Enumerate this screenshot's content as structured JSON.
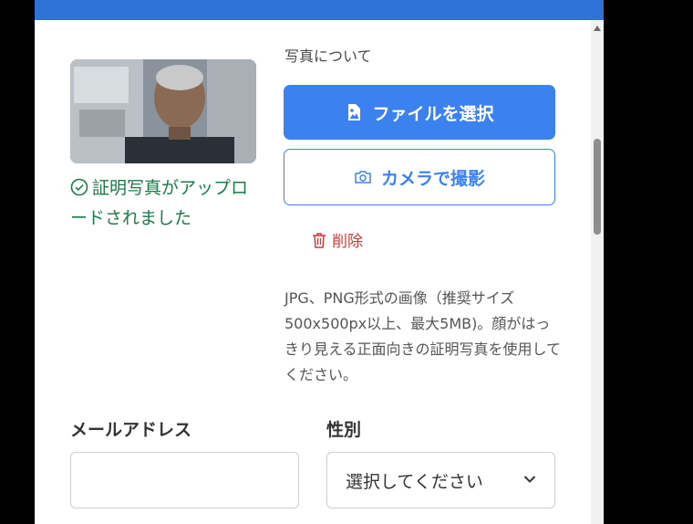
{
  "photo": {
    "section_label": "写真について",
    "upload_success": "証明写真がアップロードされました",
    "select_file_button": "ファイルを選択",
    "camera_button": "カメラで撮影",
    "delete_label": "削除",
    "help_text": "JPG、PNG形式の画像（推奨サイズ500x500px以上、最大5MB)。顔がはっきり見える正面向きの証明写真を使用してください。"
  },
  "form": {
    "email_label": "メールアドレス",
    "email_value": "",
    "gender_label": "性別",
    "gender_selected": "選択してください"
  },
  "colors": {
    "accent": "#3b82f0",
    "topbar": "#2f72d6",
    "success": "#1d7a4a",
    "danger": "#d33a3a"
  },
  "icons": {
    "success": "check-circle-icon",
    "file": "image-file-icon",
    "camera": "camera-icon",
    "delete": "trash-icon",
    "dropdown": "chevron-down-icon"
  }
}
